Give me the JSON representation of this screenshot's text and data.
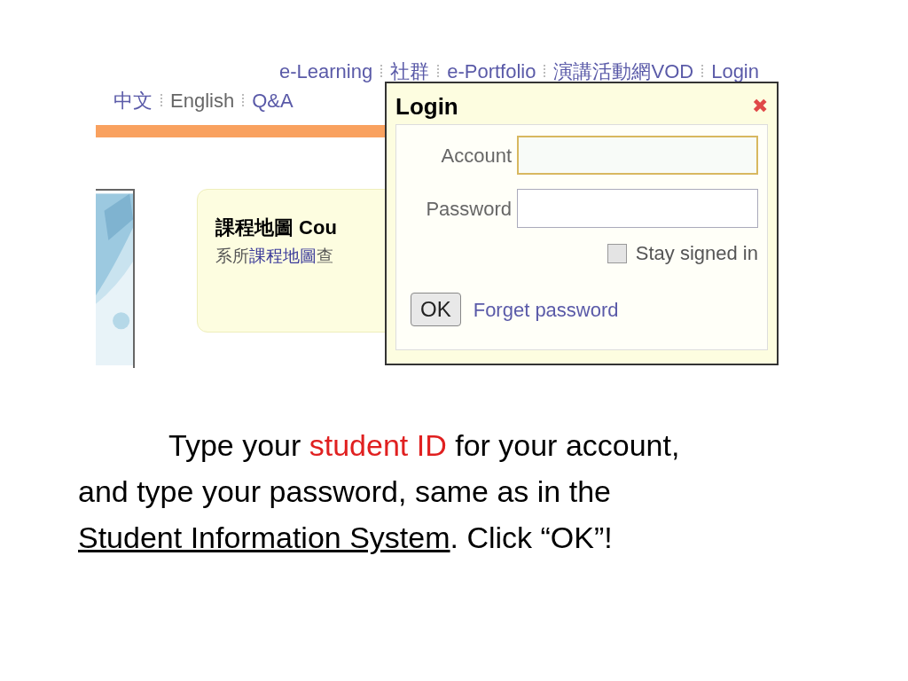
{
  "top_links": [
    "e-Learning",
    "社群",
    "e-Portfolio",
    "演講活動網VOD",
    "Login"
  ],
  "lang_links": [
    "中文",
    "English",
    "Q&A"
  ],
  "card": {
    "title": "課程地圖 Cou",
    "text_before": "系所",
    "link": "課程地圖",
    "text_after": "查"
  },
  "dialog": {
    "title": "Login",
    "close": "✖",
    "fields": [
      {
        "label": "Account",
        "focused": true
      },
      {
        "label": "Password",
        "focused": false
      }
    ],
    "stay_signed_in": {
      "label": "Stay signed in",
      "checked": false
    },
    "ok": "OK",
    "forgot": "Forget password"
  },
  "caption": [
    {
      "kind": "text",
      "text": "Type your "
    },
    {
      "kind": "highlight",
      "text": "student ID"
    },
    {
      "kind": "text",
      "text": " for your account, and type your password, same as in the "
    },
    {
      "kind": "link",
      "text": "Student Information System"
    },
    {
      "kind": "text",
      "text": ". Click “OK”!"
    }
  ]
}
